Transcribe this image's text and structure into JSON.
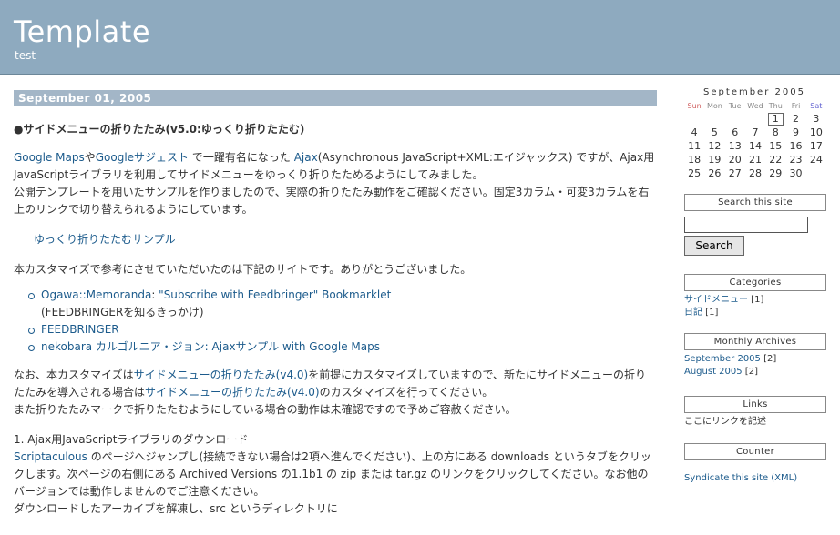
{
  "banner": {
    "title": "Template",
    "description": "test"
  },
  "entry": {
    "date": "September 01, 2005",
    "title": "●サイドメニューの折りたたみ(v5.0:ゆっくり折りたたむ)",
    "p1": {
      "link1": "Google Maps",
      "t1": "や",
      "link2": "Googleサジェスト",
      "t2": " で一躍有名になった ",
      "link3": "Ajax",
      "t3": "(Asynchronous JavaScript+XML:エイジャックス) ですが、Ajax用JavaScriptライブラリを利用してサイドメニューをゆっくり折りたためるようにしてみました。",
      "line2": "公開テンプレートを用いたサンプルを作りましたので、実際の折りたたみ動作をご確認ください。固定3カラム・可変3カラムを右上のリンクで切り替えられるようにしています。"
    },
    "sample_link": "ゆっくり折りたたむサンプル",
    "thanks": "本カスタマイズで参考にさせていただいたのは下記のサイトです。ありがとうございました。",
    "refs": [
      {
        "link_a": "Ogawa::Memoranda",
        "sep": ": ",
        "link_b": "\"Subscribe with Feedbringer\" Bookmarklet",
        "note": "(FEEDBRINGERを知るきっかけ)"
      },
      {
        "link_a": "FEEDBRINGER"
      },
      {
        "link_a": "nekobara カルゴルニア・ジョン: Ajaxサンプル with Google Maps"
      }
    ],
    "p3": {
      "t1": "なお、本カスタマイズは",
      "link1": "サイドメニューの折りたたみ(v4.0)",
      "t2": "を前提にカスタマイズしていますので、新たにサイドメニューの折りたたみを導入される場合は",
      "link2": "サイドメニューの折りたたみ(v4.0)",
      "t3": "のカスタマイズを行ってください。",
      "line2": "また折りたたみマークで折りたたむようにしている場合の動作は未確認ですので予めご容赦ください。"
    },
    "step1": {
      "heading": "1. Ajax用JavaScriptライブラリのダウンロード",
      "link": "Scriptaculous",
      "t1": " のページへジャンプし(接続できない場合は2項へ進んでください)、上の方にある downloads というタブをクリックします。次ページの右側にある Archived Versions の1.1b1 の zip または tar.gz のリンクをクリックしてください。なお他のバージョンでは動作しませんのでご注意ください。",
      "line2": "ダウンロードしたアーカイブを解凍し、src というディレクトリに"
    }
  },
  "calendar": {
    "title": "September 2005",
    "weekdays": [
      "Sun",
      "Mon",
      "Tue",
      "Wed",
      "Thu",
      "Fri",
      "Sat"
    ],
    "weeks": [
      [
        "",
        "",
        "",
        "",
        "1",
        "2",
        "3"
      ],
      [
        "4",
        "5",
        "6",
        "7",
        "8",
        "9",
        "10"
      ],
      [
        "11",
        "12",
        "13",
        "14",
        "15",
        "16",
        "17"
      ],
      [
        "18",
        "19",
        "20",
        "21",
        "22",
        "23",
        "24"
      ],
      [
        "25",
        "26",
        "27",
        "28",
        "29",
        "30",
        ""
      ]
    ],
    "highlighted_day": "1"
  },
  "search": {
    "heading": "Search this site",
    "value": "",
    "button": "Search"
  },
  "categories": {
    "heading": "Categories",
    "items": [
      {
        "name": "サイドメニュー",
        "count": " [1]"
      },
      {
        "name": "日記",
        "count": " [1]"
      }
    ]
  },
  "archives": {
    "heading": "Monthly Archives",
    "items": [
      {
        "name": "September 2005",
        "count": " [2]"
      },
      {
        "name": "August 2005",
        "count": " [2]"
      }
    ]
  },
  "links": {
    "heading": "Links",
    "text": "ここにリンクを記述"
  },
  "counter": {
    "heading": "Counter"
  },
  "syndicate": "Syndicate this site (XML)"
}
